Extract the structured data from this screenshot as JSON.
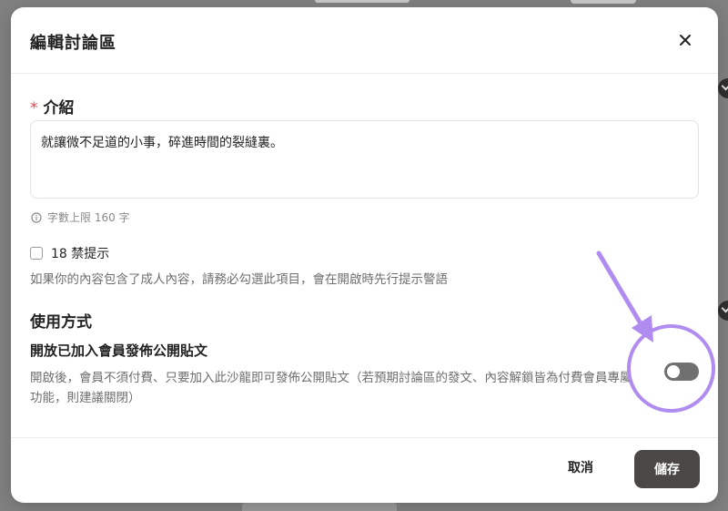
{
  "dialog": {
    "title": "編輯討論區",
    "close_icon": "close-icon"
  },
  "intro": {
    "required_mark": "*",
    "label": "介紹",
    "value": "就讓微不足道的小事，碎進時間的裂縫裏。",
    "hint": "字數上限 160 字",
    "hint_icon": "info-icon"
  },
  "nsfw": {
    "label": "18 禁提示",
    "checked": false,
    "description": "如果你的內容包含了成人內容，請務必勾選此項目，會在開啟時先行提示警語"
  },
  "usage": {
    "section_title": "使用方式",
    "option_title": "開放已加入會員發佈公開貼文",
    "option_description": "開啟後，會員不須付費、只要加入此沙龍即可發佈公開貼文（若預期討論區的發文、內容解鎖皆為付費會員專屬功能，則建議關閉）",
    "toggle_on": false
  },
  "footer": {
    "cancel_label": "取消",
    "save_label": "儲存"
  },
  "colors": {
    "annotation": "#b08cf0",
    "save_button": "#4a4744",
    "required": "#e5484d",
    "toggle_off": "#707070"
  }
}
